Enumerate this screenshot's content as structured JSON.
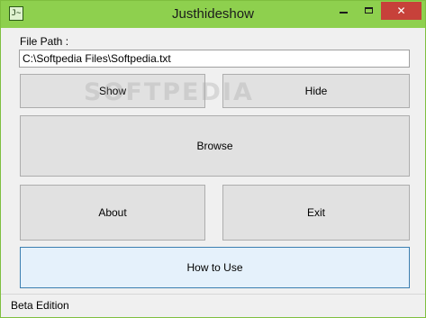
{
  "window": {
    "title": "Justhideshow",
    "icon": "j-app-icon",
    "controls": {
      "close_label": "✕"
    }
  },
  "form": {
    "path_label": "File Path :",
    "path_value": "C:\\Softpedia Files\\Softpedia.txt"
  },
  "buttons": {
    "show": "Show",
    "hide": "Hide",
    "browse": "Browse",
    "about": "About",
    "exit": "Exit",
    "how_to_use": "How to Use"
  },
  "status": {
    "text": "Beta Edition"
  },
  "watermark": {
    "text": "SOFTPEDIA"
  }
}
